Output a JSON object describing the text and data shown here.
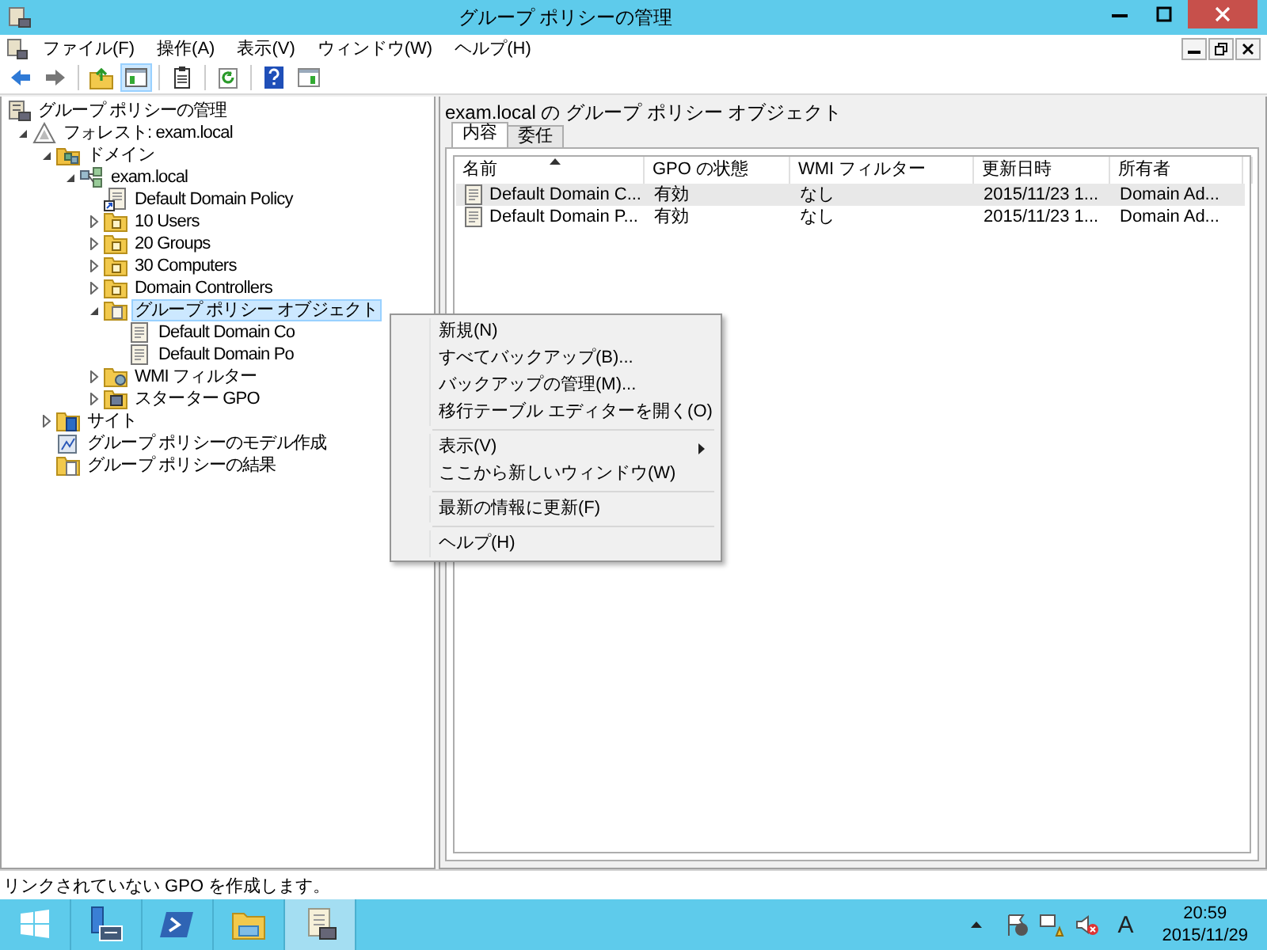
{
  "window": {
    "title": "グループ ポリシーの管理"
  },
  "menu_bar": [
    "ファイル(F)",
    "操作(A)",
    "表示(V)",
    "ウィンドウ(W)",
    "ヘルプ(H)"
  ],
  "toolbar": [
    {
      "kind": "back",
      "pressed": false
    },
    {
      "kind": "forward",
      "pressed": false
    },
    {
      "kind": "separator"
    },
    {
      "kind": "up",
      "pressed": false
    },
    {
      "kind": "tree",
      "pressed": true
    },
    {
      "kind": "separator"
    },
    {
      "kind": "properties",
      "pressed": false
    },
    {
      "kind": "separator"
    },
    {
      "kind": "refresh",
      "pressed": false
    },
    {
      "kind": "separator"
    },
    {
      "kind": "help",
      "pressed": false
    },
    {
      "kind": "pane",
      "pressed": false
    }
  ],
  "tree": [
    {
      "label": "グループ ポリシーの管理",
      "kind": "root",
      "selected": false,
      "children": [
        {
          "label": "フォレスト: exam.local",
          "kind": "forest",
          "expanded": true,
          "selected": false,
          "children": [
            {
              "label": "ドメイン",
              "kind": "domains",
              "expanded": true,
              "selected": false,
              "children": [
                {
                  "label": "exam.local",
                  "kind": "domain",
                  "expanded": true,
                  "selected": false,
                  "children": [
                    {
                      "label": "Default Domain Policy",
                      "kind": "link",
                      "selected": false
                    },
                    {
                      "label": "10 Users",
                      "kind": "ou",
                      "expanded": false,
                      "selected": false
                    },
                    {
                      "label": "20 Groups",
                      "kind": "ou",
                      "expanded": false,
                      "selected": false
                    },
                    {
                      "label": "30 Computers",
                      "kind": "ou",
                      "expanded": false,
                      "selected": false
                    },
                    {
                      "label": "Domain Controllers",
                      "kind": "ou",
                      "expanded": false,
                      "selected": false
                    },
                    {
                      "label": "グループ ポリシー オブジェクト",
                      "kind": "container",
                      "expanded": true,
                      "selected": true,
                      "children": [
                        {
                          "label": "Default Domain Co",
                          "kind": "gpo",
                          "selected": false
                        },
                        {
                          "label": "Default Domain Po",
                          "kind": "gpo",
                          "selected": false
                        }
                      ]
                    },
                    {
                      "label": "WMI フィルター",
                      "kind": "wmi",
                      "expanded": false,
                      "selected": false
                    },
                    {
                      "label": "スターター GPO",
                      "kind": "starter",
                      "expanded": false,
                      "selected": false
                    }
                  ]
                }
              ]
            },
            {
              "label": "サイト",
              "kind": "sites",
              "expanded": false,
              "selected": false
            },
            {
              "label": "グループ ポリシーのモデル作成",
              "kind": "modeling",
              "selected": false
            },
            {
              "label": "グループ ポリシーの結果",
              "kind": "results",
              "selected": false
            }
          ]
        }
      ]
    }
  ],
  "context_menu": [
    {
      "kind": "item",
      "label": "新規(N)",
      "submenu": false
    },
    {
      "kind": "item",
      "label": "すべてバックアップ(B)...",
      "submenu": false
    },
    {
      "kind": "item",
      "label": "バックアップの管理(M)...",
      "submenu": false
    },
    {
      "kind": "item",
      "label": "移行テーブル エディターを開く(O)",
      "submenu": false
    },
    {
      "kind": "separator"
    },
    {
      "kind": "item",
      "label": "表示(V)",
      "submenu": true
    },
    {
      "kind": "item",
      "label": "ここから新しいウィンドウ(W)",
      "submenu": false
    },
    {
      "kind": "separator"
    },
    {
      "kind": "item",
      "label": "最新の情報に更新(F)",
      "submenu": false
    },
    {
      "kind": "separator"
    },
    {
      "kind": "item",
      "label": "ヘルプ(H)",
      "submenu": false
    }
  ],
  "details": {
    "title": "exam.local の グループ ポリシー オブジェクト",
    "tabs": [
      {
        "label": "内容",
        "selected": true
      },
      {
        "label": "委任",
        "selected": false
      }
    ],
    "table": {
      "columns": [
        {
          "label": "名前",
          "sorted": true
        },
        {
          "label": "GPO の状態",
          "sorted": false
        },
        {
          "label": "WMI フィルター",
          "sorted": false
        },
        {
          "label": "更新日時",
          "sorted": false
        },
        {
          "label": "所有者",
          "sorted": false
        }
      ],
      "rows": [
        {
          "selected": true,
          "cells": [
            "Default Domain C...",
            "有効",
            "なし",
            "2015/11/23 1...",
            "Domain Ad..."
          ]
        },
        {
          "selected": false,
          "cells": [
            "Default Domain P...",
            "有効",
            "なし",
            "2015/11/23 1...",
            "Domain Ad..."
          ]
        }
      ]
    }
  },
  "status_bar": {
    "text": "リンクされていない GPO を作成します。"
  },
  "taskbar": {
    "items": [
      {
        "kind": "start",
        "active": false
      },
      {
        "kind": "server",
        "active": false
      },
      {
        "kind": "shell",
        "active": false
      },
      {
        "kind": "explorer",
        "active": false
      },
      {
        "kind": "gpmc",
        "active": true
      }
    ],
    "ime": "A",
    "time": "20:59",
    "date": "2015/11/29"
  }
}
